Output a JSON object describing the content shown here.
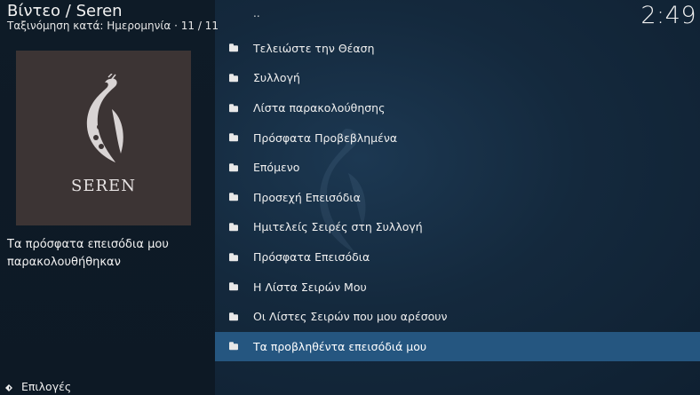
{
  "header": {
    "title": "Βίντεο / Seren",
    "subtitle": "Ταξινόμηση κατά: Ημερομηνία  ·  11 / 11",
    "clock": "2:49"
  },
  "thumbnail": {
    "label": "SEREN"
  },
  "description": "Τα πρόσφατα επεισόδια μου παρακολουθήθηκαν",
  "list": {
    "parent": "..",
    "items": [
      "Τελειώστε την Θέαση",
      "Συλλογή",
      "Λίστα παρακολούθησης",
      "Πρόσφατα Προβεβλημένα",
      "Επόμενο",
      "Προσεχή Επεισόδια",
      "Ημιτελείς Σειρές στη Συλλογή",
      "Πρόσφατα Επεισόδια",
      "Η Λίστα Σειρών Μου",
      "Οι Λίστες Σειρών που μου αρέσουν",
      "Τα προβληθέντα επεισόδιά μου"
    ]
  },
  "footer": {
    "options": "Επιλογές"
  },
  "colors": {
    "selection": "#255680",
    "background": "#0c1a27"
  }
}
